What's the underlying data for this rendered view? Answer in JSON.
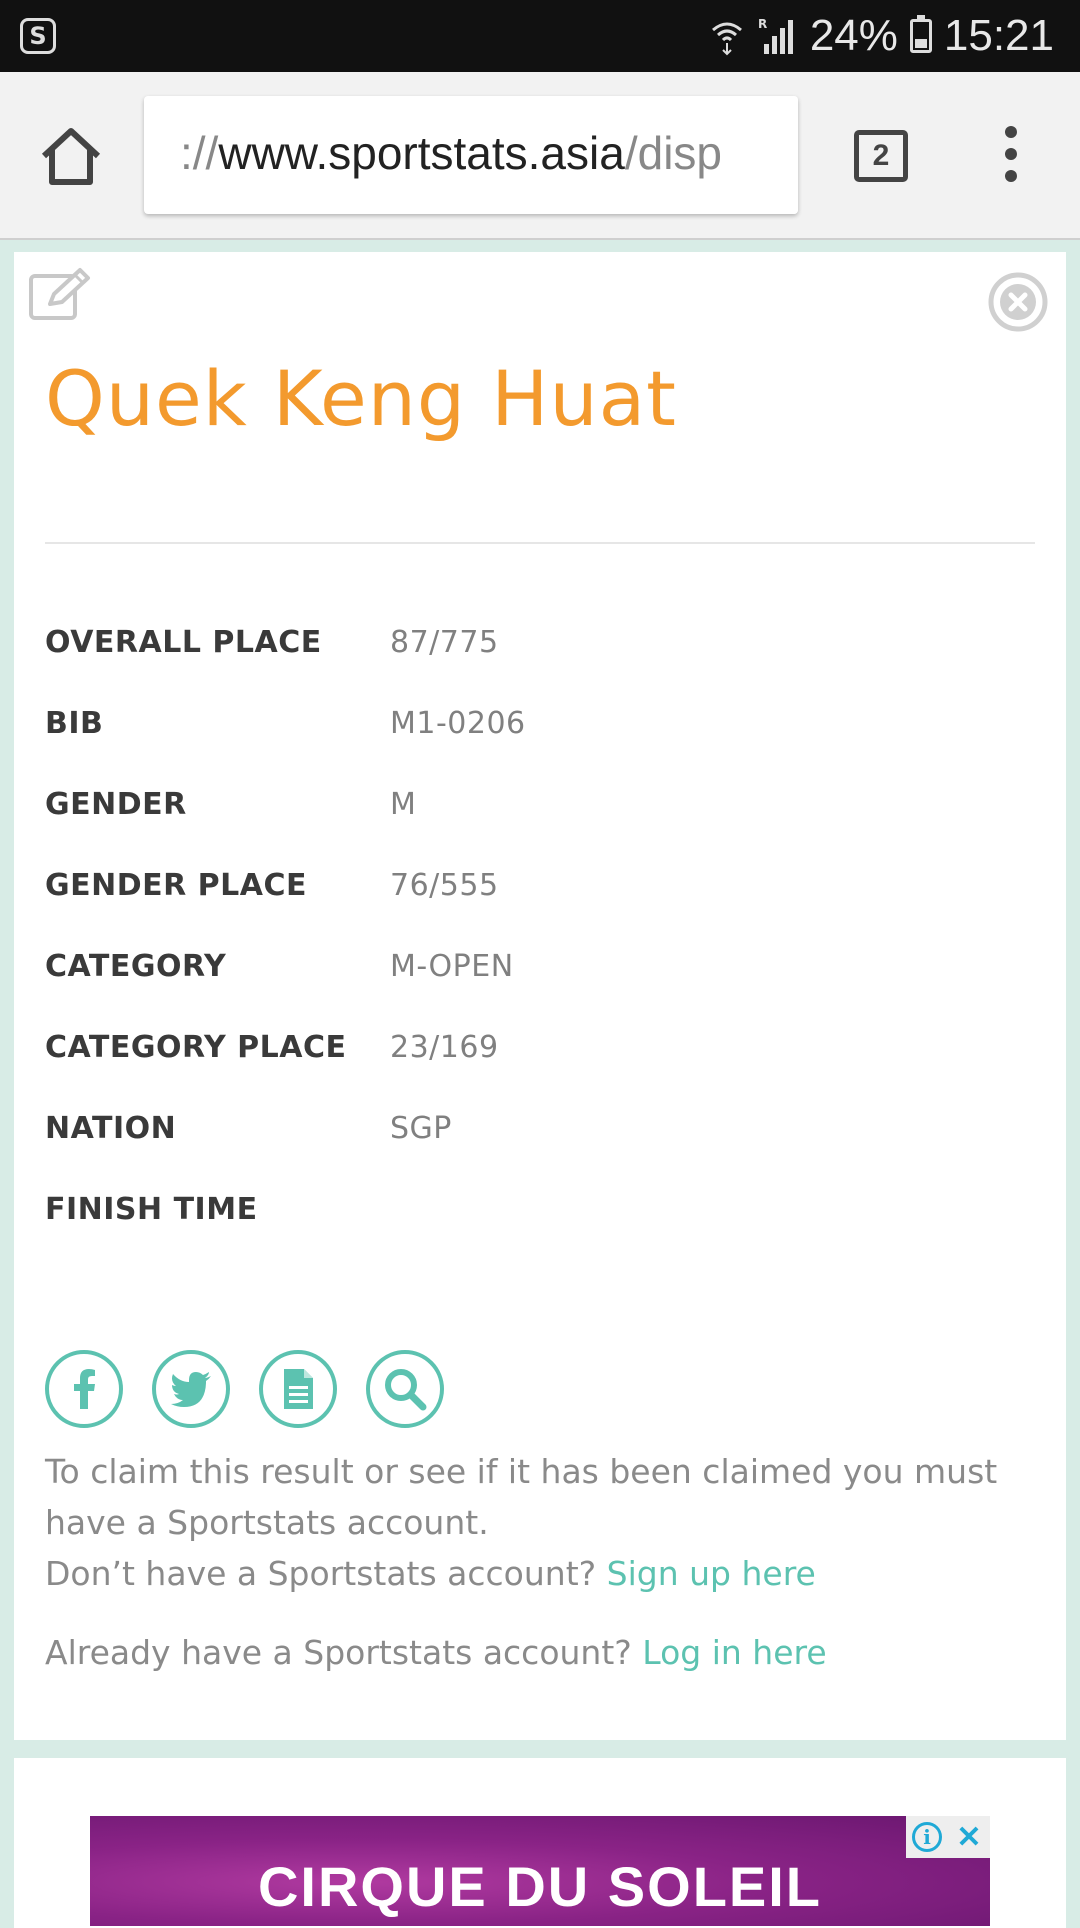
{
  "status_bar": {
    "battery": "24%",
    "time": "15:21"
  },
  "browser": {
    "url_prefix": "://",
    "url_host": "www.sportstats.asia",
    "url_path": "/disp",
    "tab_count": "2"
  },
  "athlete": {
    "name": "Quek Keng Huat"
  },
  "stats": [
    {
      "label": "OVERALL PLACE",
      "value": "87/775"
    },
    {
      "label": "BIB",
      "value": "M1-0206"
    },
    {
      "label": "GENDER",
      "value": "M"
    },
    {
      "label": "GENDER PLACE",
      "value": "76/555"
    },
    {
      "label": "CATEGORY",
      "value": "M-OPEN"
    },
    {
      "label": "CATEGORY PLACE",
      "value": "23/169"
    },
    {
      "label": "NATION",
      "value": "SGP"
    },
    {
      "label": "FINISH TIME",
      "value": ""
    }
  ],
  "claim": {
    "line1": "To claim this result or see if it has been claimed you must have a Sportstats account.",
    "signup_prompt": "Don’t have a Sportstats account? ",
    "signup_link": "Sign up here",
    "login_prompt": "Already have a Sportstats account? ",
    "login_link": "Log in here"
  },
  "ad": {
    "text": "CIRQUE DU SOLEIL",
    "close": "✕",
    "info": "i"
  },
  "colors": {
    "accent_orange": "#f39a2e",
    "accent_teal": "#5cc2b0",
    "ad_blue": "#1fa9d6"
  },
  "icons": [
    "edit-icon",
    "close-circle-icon",
    "facebook-icon",
    "twitter-icon",
    "document-icon",
    "search-icon",
    "home-icon",
    "menu-icon"
  ]
}
